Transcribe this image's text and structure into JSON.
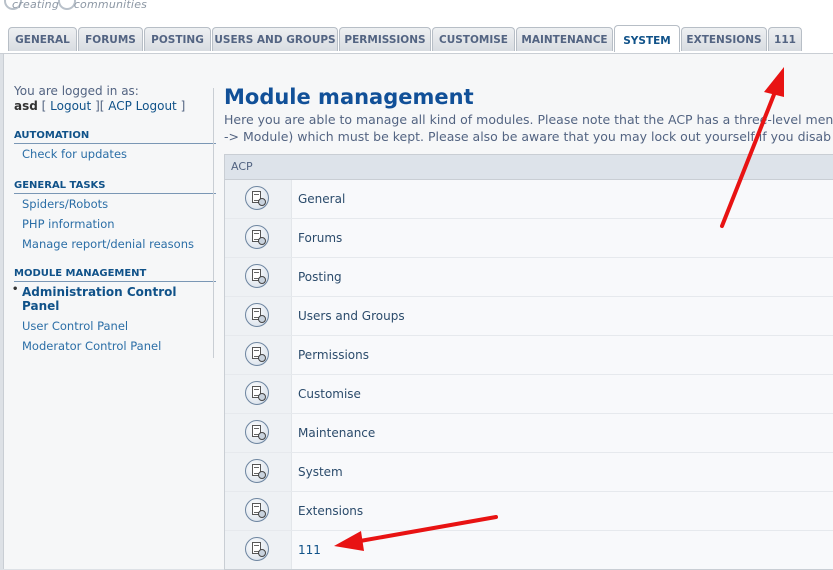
{
  "branding": {
    "tagline_left": "creating",
    "tagline_right": "communities"
  },
  "tabs": [
    {
      "label": "GENERAL",
      "active": false
    },
    {
      "label": "FORUMS",
      "active": false
    },
    {
      "label": "POSTING",
      "active": false
    },
    {
      "label": "USERS AND GROUPS",
      "active": false
    },
    {
      "label": "PERMISSIONS",
      "active": false
    },
    {
      "label": "CUSTOMISE",
      "active": false
    },
    {
      "label": "MAINTENANCE",
      "active": false
    },
    {
      "label": "SYSTEM",
      "active": true
    },
    {
      "label": "EXTENSIONS",
      "active": false
    },
    {
      "label": "111",
      "active": false
    }
  ],
  "login": {
    "prefix": "You are logged in as:",
    "username": "asd",
    "logout": "Logout",
    "acp_logout": "ACP Logout"
  },
  "sidebar": {
    "sections": [
      {
        "title": "AUTOMATION",
        "items": [
          {
            "label": "Check for updates",
            "active": false
          }
        ]
      },
      {
        "title": "GENERAL TASKS",
        "items": [
          {
            "label": "Spiders/Robots",
            "active": false
          },
          {
            "label": "PHP information",
            "active": false
          },
          {
            "label": "Manage report/denial reasons",
            "active": false
          }
        ]
      },
      {
        "title": "MODULE MANAGEMENT",
        "items": [
          {
            "label": "Administration Control Panel",
            "active": true
          },
          {
            "label": "User Control Panel",
            "active": false
          },
          {
            "label": "Moderator Control Panel",
            "active": false
          }
        ]
      }
    ]
  },
  "main": {
    "title": "Module management",
    "description_line1": "Here you are able to manage all kind of modules. Please note that the ACP has a three-level men",
    "description_line2": "-> Module) which must be kept. Please also be aware that you may lock out yourself if you disab",
    "table_header": "ACP",
    "modules": [
      "General",
      "Forums",
      "Posting",
      "Users and Groups",
      "Permissions",
      "Customise",
      "Maintenance",
      "System",
      "Extensions",
      "111"
    ]
  },
  "colors": {
    "accent": "#105289",
    "arrow": "#e81313"
  }
}
